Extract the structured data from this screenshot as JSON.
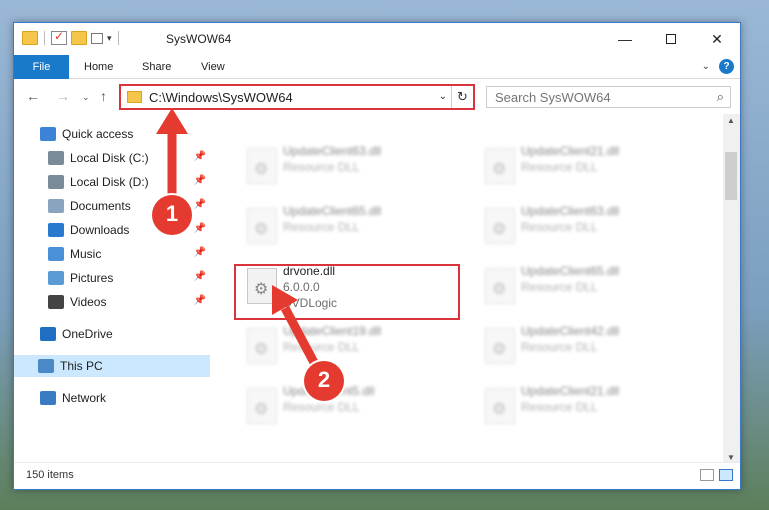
{
  "window": {
    "title": "SysWOW64",
    "controls": {
      "minimize": "—",
      "maximize": "",
      "close": "✕"
    }
  },
  "ribbon": {
    "tabs": [
      "File",
      "Home",
      "Share",
      "View"
    ],
    "expand_icon": "chevron-down-icon",
    "help_icon": "?"
  },
  "address": {
    "path": "C:\\Windows\\SysWOW64",
    "search_placeholder": "Search SysWOW64"
  },
  "sidebar": {
    "items": [
      {
        "label": "Quick access",
        "icon": "star-icon",
        "color": "#3c82d8"
      },
      {
        "label": "Local Disk (C:)",
        "icon": "drive-icon",
        "color": "#7a8a99",
        "pinned": true
      },
      {
        "label": "Local Disk (D:)",
        "icon": "drive-icon",
        "color": "#7a8a99",
        "pinned": true
      },
      {
        "label": "Documents",
        "icon": "documents-icon",
        "color": "#8aa3bf",
        "pinned": true
      },
      {
        "label": "Downloads",
        "icon": "downloads-icon",
        "color": "#2a79d0",
        "pinned": true
      },
      {
        "label": "Music",
        "icon": "music-icon",
        "color": "#4a90d9",
        "pinned": true
      },
      {
        "label": "Pictures",
        "icon": "pictures-icon",
        "color": "#5a9bd6",
        "pinned": true
      },
      {
        "label": "Videos",
        "icon": "videos-icon",
        "color": "#444444",
        "pinned": true
      },
      {
        "label": "OneDrive",
        "icon": "cloud-icon",
        "color": "#1e6fc4"
      },
      {
        "label": "This PC",
        "icon": "computer-icon",
        "color": "#4a88c7",
        "selected": true
      },
      {
        "label": "Network",
        "icon": "network-icon",
        "color": "#3a7bc4"
      }
    ]
  },
  "files": {
    "left": [
      {
        "name": "UpdateClient63.dll",
        "sub": "Resource DLL"
      },
      {
        "name": "UpdateClient65.dll",
        "sub": "Resource DLL"
      },
      {
        "name": "drvone.dll",
        "sub": "6.0.0.0",
        "sub2": "DVDLogic"
      },
      {
        "name": "UpdateClient19.dll",
        "sub": "Resource DLL"
      },
      {
        "name": "UpdateClient5.dll",
        "sub": "Resource DLL"
      }
    ],
    "right": [
      {
        "name": "UpdateClient21.dll",
        "sub": "Resource DLL"
      },
      {
        "name": "UpdateClient63.dll",
        "sub": "Resource DLL"
      },
      {
        "name": "UpdateClient65.dll",
        "sub": "Resource DLL"
      },
      {
        "name": "UpdateClient42.dll",
        "sub": "Resource DLL"
      },
      {
        "name": "UpdateClient21.dll",
        "sub": "Resource DLL"
      }
    ]
  },
  "status": {
    "item_count": "150 items"
  },
  "annotations": {
    "step1": "1",
    "step2": "2",
    "color": "#e43a2f"
  }
}
